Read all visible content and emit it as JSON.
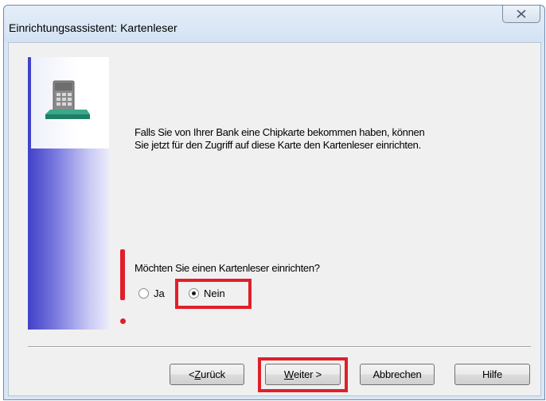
{
  "window": {
    "title": "Einrichtungsassistent: Kartenleser",
    "close_glyph": "☒"
  },
  "content": {
    "description_line1": "Falls Sie von Ihrer Bank eine Chipkarte bekommen haben, können",
    "description_line2": "Sie jetzt für den Zugriff auf diese Karte den Kartenleser einrichten.",
    "question": "Möchten Sie einen Kartenleser einrichten?",
    "options": [
      {
        "label": "Ja",
        "checked": false
      },
      {
        "label": "Nein",
        "checked": true
      }
    ]
  },
  "buttons": {
    "back": {
      "accel": "Z",
      "rest": "urück",
      "prefix": "< "
    },
    "next": {
      "accel": "W",
      "rest": "eiter >"
    },
    "cancel": "Abbrechen",
    "help": "Hilfe"
  },
  "colors": {
    "highlight": "#e01f2a",
    "side_panel": "#4040c8"
  },
  "icons": {
    "header": "card-reader-icon"
  }
}
